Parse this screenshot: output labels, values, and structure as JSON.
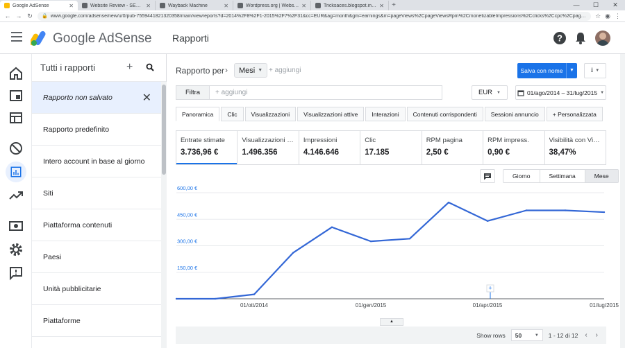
{
  "browser": {
    "tabs": [
      {
        "title": "Google AdSense",
        "color": "#fbbc04",
        "active": true
      },
      {
        "title": "Website Review - SEO TOOL | Ra...",
        "color": "#5f6368",
        "active": false
      },
      {
        "title": "Wayback Machine",
        "color": "#5f6368",
        "active": false
      },
      {
        "title": "Wordpress.org | Website Review...",
        "color": "#5f6368",
        "active": false
      },
      {
        "title": "Tricksaces.blogspot.in | Ca2r.p...",
        "color": "#5f6368",
        "active": false
      }
    ],
    "url": "www.google.com/adsense/new/u/0/pub-7559441821320358/main/viewreports?d=2014%2F8%2F1-2015%2F7%2F31&cc=EUR&ag=month&gm=earnings&m=pageViews%2CpageViewsRpm%2CmonetizableImpressions%2Cclicks%2Ccpc%2CpageViewsCtr&oo=ascend..."
  },
  "header": {
    "brand": "Google AdSense",
    "title": "Rapporti"
  },
  "panel": {
    "title": "Tutti i rapporti",
    "add": "+",
    "current_item": "Rapporto non salvato",
    "items": [
      "Rapporto predefinito",
      "Intero account in base al giorno",
      "Siti",
      "Piattaforma contenuti",
      "Paesi",
      "Unità pubblicitarie",
      "Piattaforme"
    ]
  },
  "report": {
    "label": "Rapporto per",
    "chevron": "›",
    "dimension": "Mesi",
    "add": "+ aggiungi",
    "save_label": "Salva con nome",
    "filter_label": "Filtra",
    "filter_add": "+ aggiungi",
    "currency": "EUR",
    "date_range": "01/ago/2014 – 31/lug/2015"
  },
  "tabs": [
    "Panoramica",
    "Clic",
    "Visualizzazioni",
    "Visualizzazioni attive",
    "Interazioni",
    "Contenuti corrispondenti",
    "Sessioni annuncio",
    "+ Personalizzata"
  ],
  "metrics": [
    {
      "label": "Entrate stimate",
      "value": "3.736,96 €"
    },
    {
      "label": "Visualizzazioni d...",
      "value": "1.496.356"
    },
    {
      "label": "Impressioni",
      "value": "4.146.646"
    },
    {
      "label": "Clic",
      "value": "17.185"
    },
    {
      "label": "RPM pagina",
      "value": "2,50 €"
    },
    {
      "label": "RPM impress.",
      "value": "0,90 €"
    },
    {
      "label": "Visibilità con Vis...",
      "value": "38,47%"
    }
  ],
  "granularity": [
    "Giorno",
    "Settimana",
    "Mese"
  ],
  "chart_data": {
    "type": "line",
    "x": [
      "2014-08",
      "2014-09",
      "2014-10",
      "2014-11",
      "2014-12",
      "2015-01",
      "2015-02",
      "2015-03",
      "2015-04",
      "2015-05",
      "2015-06",
      "2015-07"
    ],
    "series": [
      {
        "values": [
          0,
          0,
          25,
          260,
          405,
          325,
          340,
          545,
          440,
          500,
          500,
          490
        ]
      }
    ],
    "ylim": [
      0,
      600
    ],
    "yticks": [
      "150,00 €",
      "300,00 €",
      "450,00 €",
      "600,00 €"
    ],
    "ytick_values": [
      150,
      300,
      450,
      600
    ],
    "xticks": [
      "01/ott/2014",
      "01/gen/2015",
      "01/apr/2015",
      "01/lug/2015"
    ],
    "xtick_index": [
      2,
      5,
      8,
      11
    ],
    "color": "#3367d6"
  },
  "footer": {
    "show_rows_label": "Show rows",
    "rows": "50",
    "range": "1 - 12 di 12"
  }
}
